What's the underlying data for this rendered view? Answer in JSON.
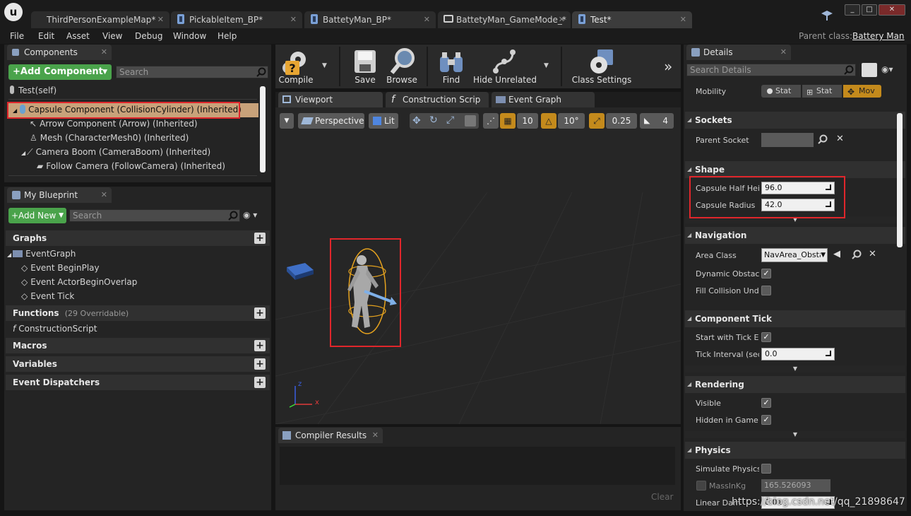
{
  "title_bar": {
    "tabs": [
      {
        "label": "ThirdPersonExampleMap*"
      },
      {
        "label": "PickableItem_BP*"
      },
      {
        "label": "BattetyMan_BP*"
      },
      {
        "label": "BattetyMan_GameMode_*"
      },
      {
        "label": "Test*"
      }
    ],
    "window_buttons": [
      "_",
      "□",
      "✕"
    ]
  },
  "menu": {
    "items": [
      "File",
      "Edit",
      "Asset",
      "View",
      "Debug",
      "Window",
      "Help"
    ],
    "parent_class_label": "Parent class:",
    "parent_class_value": "Battery Man"
  },
  "components": {
    "tab_label": "Components",
    "add_button": "+Add Component",
    "search_placeholder": "Search",
    "items": [
      "Test(self)",
      "Capsule Component (CollisionCylinder) (Inherited)",
      "Arrow Component (Arrow) (Inherited)",
      "Mesh (CharacterMesh0) (Inherited)",
      "Camera Boom (CameraBoom) (Inherited)",
      "Follow Camera (FollowCamera) (Inherited)"
    ]
  },
  "my_blueprint": {
    "tab_label": "My Blueprint",
    "add_button": "+Add New",
    "search_placeholder": "Search",
    "graphs_label": "Graphs",
    "event_graph": "EventGraph",
    "events": [
      "Event BeginPlay",
      "Event ActorBeginOverlap",
      "Event Tick"
    ],
    "functions_label": "Functions",
    "functions_note": "(29 Overridable)",
    "construction_script": "ConstructionScript",
    "macros_label": "Macros",
    "variables_label": "Variables",
    "dispatchers_label": "Event Dispatchers"
  },
  "toolbar": {
    "compile": "Compile",
    "save": "Save",
    "browse": "Browse",
    "find": "Find",
    "hide_unrelated": "Hide Unrelated",
    "class_settings": "Class Settings"
  },
  "editor_tabs": [
    "Viewport",
    "Construction Scrip",
    "Event Graph"
  ],
  "viewport": {
    "perspective": "Perspective",
    "lit": "Lit",
    "grid_snap": "10",
    "rot_snap": "10°",
    "scale_snap": "0.25",
    "camera_speed": "4",
    "axis_z": "z",
    "axis_x": "x"
  },
  "compiler": {
    "tab_label": "Compiler Results",
    "clear": "Clear"
  },
  "details": {
    "tab_label": "Details",
    "search_placeholder": "Search Details",
    "mobility_label": "Mobility",
    "mobility_options": [
      "Stat",
      "Stat",
      "Mov"
    ],
    "sockets_header": "Sockets",
    "parent_socket": "Parent Socket",
    "shape_header": "Shape",
    "capsule_half_height_label": "Capsule Half Heig",
    "capsule_half_height_value": "96.0",
    "capsule_radius_label": "Capsule Radius",
    "capsule_radius_value": "42.0",
    "navigation_header": "Navigation",
    "area_class_label": "Area Class",
    "area_class_value": "NavArea_Obsta",
    "dynamic_obstacle_label": "Dynamic Obstacle",
    "fill_collision_label": "Fill Collision Unde",
    "component_tick_header": "Component Tick",
    "start_with_tick_label": "Start with Tick En",
    "tick_interval_label": "Tick Interval (sec",
    "tick_interval_value": "0.0",
    "rendering_header": "Rendering",
    "visible_label": "Visible",
    "hidden_in_game_label": "Hidden in Game",
    "physics_header": "Physics",
    "simulate_physics_label": "Simulate Physics",
    "mass_label": "MassInKg",
    "mass_value": "165.526093",
    "linear_damping_label": "Linear Dam",
    "linear_damping_value": "0.01"
  },
  "watermark": "https://blog.csdn.net/qq_21898647",
  "colors": {
    "accent_orange": "#c48a1c",
    "highlight_row": "#c8a27a",
    "add_green": "#4aa34b",
    "annotation_red": "#e0262b"
  }
}
